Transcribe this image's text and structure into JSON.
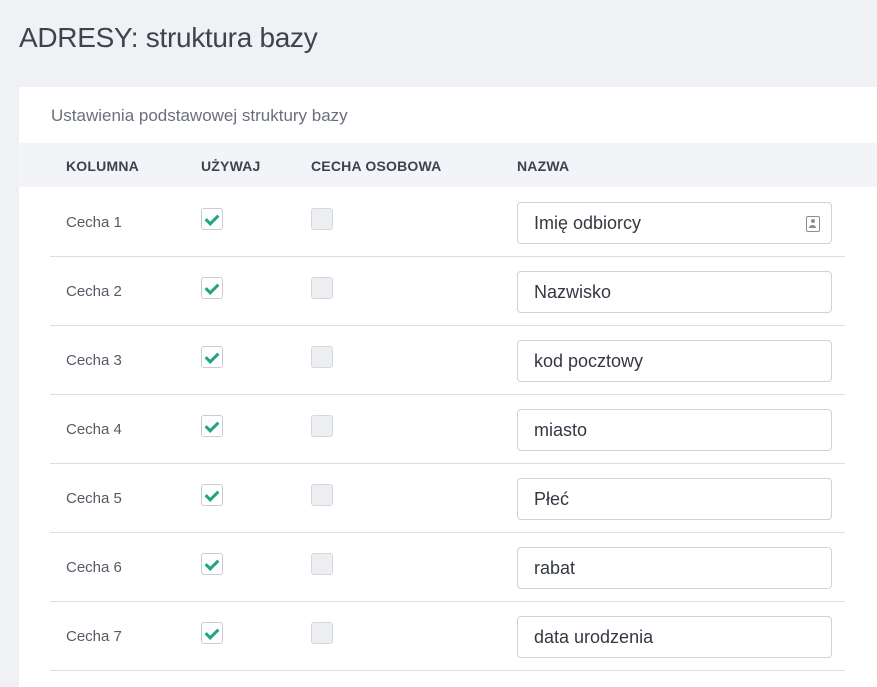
{
  "page": {
    "title": "ADRESY: struktura bazy"
  },
  "card": {
    "title": "Ustawienia podstawowej struktury bazy",
    "columns": {
      "kolumna": "KOLUMNA",
      "uzywaj": "UŻYWAJ",
      "cecha_osobowa": "CECHA OSOBOWA",
      "nazwa": "NAZWA"
    },
    "rows": [
      {
        "label": "Cecha 1",
        "use": true,
        "personal": false,
        "name": "Imię odbiorcy"
      },
      {
        "label": "Cecha 2",
        "use": true,
        "personal": false,
        "name": "Nazwisko"
      },
      {
        "label": "Cecha 3",
        "use": true,
        "personal": false,
        "name": "kod pocztowy"
      },
      {
        "label": "Cecha 4",
        "use": true,
        "personal": false,
        "name": "miasto"
      },
      {
        "label": "Cecha 5",
        "use": true,
        "personal": false,
        "name": "Płeć"
      },
      {
        "label": "Cecha 6",
        "use": true,
        "personal": false,
        "name": "rabat"
      },
      {
        "label": "Cecha 7",
        "use": true,
        "personal": false,
        "name": "data urodzenia"
      }
    ]
  },
  "icons": {
    "checkmark": "checkmark-icon",
    "contact_card": "contact-card-icon"
  },
  "colors": {
    "check": "#1fa57f",
    "background": "#f0f1f5",
    "header_row": "#f3f4f8"
  }
}
